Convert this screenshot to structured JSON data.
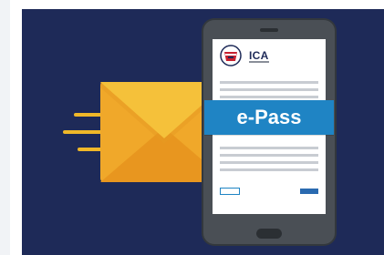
{
  "logo": {
    "name": "ICA"
  },
  "banner": {
    "label": "e-Pass"
  },
  "colors": {
    "background": "#1e2a58",
    "accent": "#1f84c4",
    "envelope": "#f0b829",
    "phone_body": "#4a4f55"
  },
  "icons": [
    "envelope-icon",
    "phone-icon",
    "ica-crest-icon"
  ]
}
